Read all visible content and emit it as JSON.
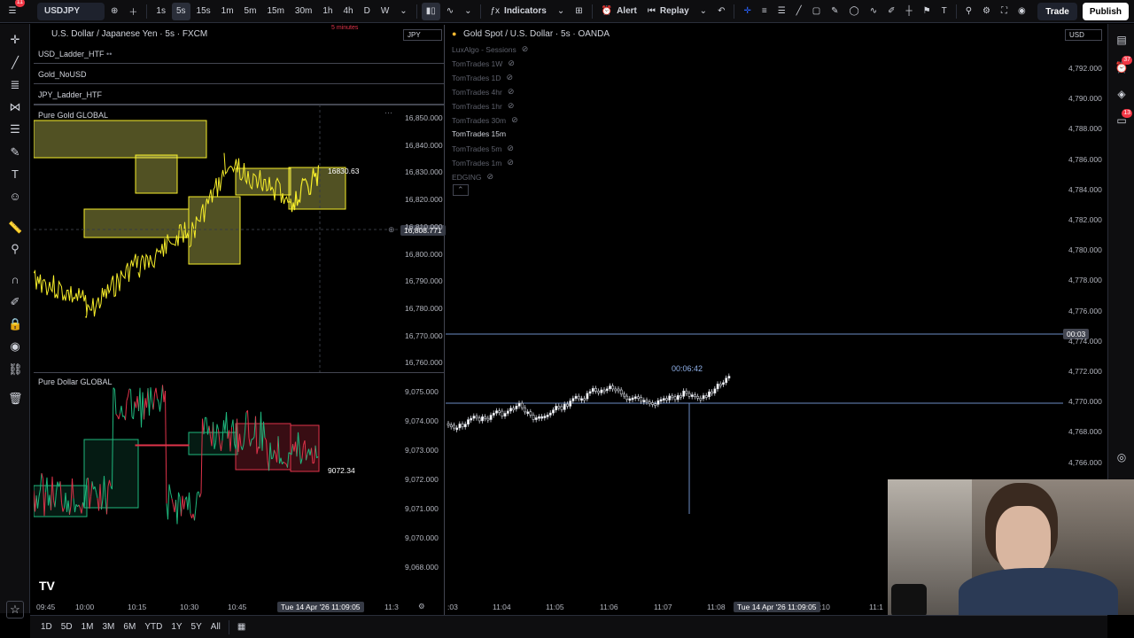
{
  "toolbar": {
    "symbol": "USDJPY",
    "intervals": [
      "1s",
      "5s",
      "15s",
      "1m",
      "5m",
      "15m",
      "30m",
      "1h",
      "4h",
      "D",
      "W"
    ],
    "active_interval": "5s",
    "indicators_label": "Indicators",
    "alert_label": "Alert",
    "replay_label": "Replay",
    "trade_label": "Trade",
    "publish_label": "Publish",
    "notif_count": "11"
  },
  "left_chart": {
    "title": "U.S. Dollar / Japanese Yen · 5s · FXCM",
    "currency": "JPY",
    "countdown": "5 minutes",
    "studies": [
      "USD_Ladder_HTF",
      "Gold_NoUSD",
      "JPY_Ladder_HTF"
    ],
    "pane1": {
      "title": "Pure Gold GLOBAL",
      "axis": [
        "16,850.000",
        "16,840.000",
        "16,830.000",
        "16,820.000",
        "16,810.000",
        "16,800.000",
        "16,790.000",
        "16,780.000",
        "16,770.000",
        "16,760.000"
      ],
      "last_label": "16830.63",
      "crosshair_price": "16,808.771"
    },
    "pane2": {
      "title": "Pure Dollar GLOBAL",
      "axis": [
        "9,075.000",
        "9,074.000",
        "9,073.000",
        "9,072.000",
        "9,071.000",
        "9,070.000",
        "9,068.000"
      ],
      "last_label": "9072.34"
    },
    "time_axis": [
      "09:45",
      "10:00",
      "10:15",
      "10:30",
      "10:45",
      "11:3"
    ],
    "time_cursor": "Tue 14 Apr '26   11:09:05"
  },
  "right_chart": {
    "title": "Gold Spot / U.S. Dollar · 5s · OANDA",
    "currency": "USD",
    "legend": [
      {
        "label": "LuxAlgo - Sessions",
        "on": false
      },
      {
        "label": "TomTrades 1W",
        "on": false
      },
      {
        "label": "TomTrades 1D",
        "on": false
      },
      {
        "label": "TomTrades 4hr",
        "on": false
      },
      {
        "label": "TomTrades 1hr",
        "on": false
      },
      {
        "label": "TomTrades 30m",
        "on": false
      },
      {
        "label": "TomTrades 15m",
        "on": true
      },
      {
        "label": "TomTrades 5m",
        "on": false
      },
      {
        "label": "TomTrades 1m",
        "on": false
      },
      {
        "label": "EDGING",
        "on": false
      }
    ],
    "axis": [
      "4,792.000",
      "4,790.000",
      "4,788.000",
      "4,786.000",
      "4,784.000",
      "4,782.000",
      "4,780.000",
      "4,778.000",
      "4,776.000",
      "4,774.000",
      "4,772.000",
      "4,770.000",
      "4,768.000",
      "4,766.000"
    ],
    "measure_label": "00:06:42",
    "current_tag": "00:03",
    "time_axis": [
      ":03",
      "11:04",
      "11:05",
      "11:06",
      "11:07",
      "11:08",
      ":10",
      "11:1"
    ],
    "time_cursor": "Tue 14 Apr '26   11:09:05"
  },
  "bottom": {
    "ranges": [
      "1D",
      "5D",
      "1M",
      "3M",
      "6M",
      "YTD",
      "1Y",
      "5Y",
      "All"
    ]
  },
  "colors": {
    "gold": "#f7ee2a",
    "green": "#1fb87e",
    "red": "#e0334a",
    "box": "rgba(233,233,100,0.35)"
  }
}
